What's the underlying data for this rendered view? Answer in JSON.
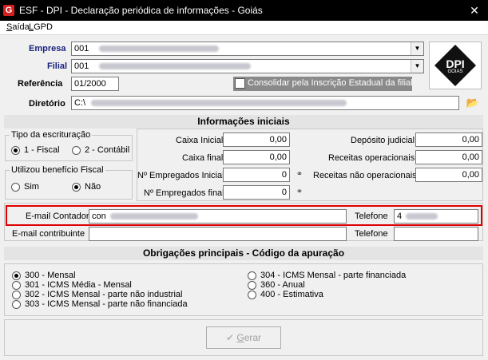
{
  "window": {
    "title": "ESF - DPI - Declaração periódica de informações - Goiás",
    "app_icon": "G",
    "close_icon": "✕"
  },
  "menu": {
    "items": [
      {
        "label_ul": "S",
        "label_rest": "aída"
      },
      {
        "label_ul": "L",
        "label_rest": "GPD"
      }
    ]
  },
  "header": {
    "empresa_label": "Empresa",
    "empresa_value": "001",
    "filial_label": "Filial",
    "filial_value": "001",
    "referencia_label": "Referência",
    "referencia_value": "01/2000",
    "consolidar_label": "Consolidar pela Inscrição Estadual da filial",
    "diretorio_label": "Diretório",
    "diretorio_value": "C:\\",
    "logo_text": "DPI",
    "logo_sub": "GOIAS"
  },
  "info_iniciais": {
    "title": "Informações iniciais",
    "escrituracao": {
      "title": "Tipo da escrituração",
      "opt1": "1 - Fiscal",
      "opt2": "2 - Contábil"
    },
    "beneficio": {
      "title": "Utilizou benefício Fiscal",
      "opt1": "Sim",
      "opt2": "Não"
    },
    "caixa_inicial_label": "Caixa Inicial",
    "caixa_inicial_value": "0,00",
    "caixa_final_label": "Caixa final",
    "caixa_final_value": "0,00",
    "empregados_inicial_label": "Nº Empregados Inicial",
    "empregados_inicial_value": "0",
    "empregados_final_label": "Nº Empregados final",
    "empregados_final_value": "0",
    "deposito_label": "Depósito judicial",
    "deposito_value": "0,00",
    "receitas_op_label": "Receitas operacionais",
    "receitas_op_value": "0,00",
    "receitas_nao_op_label": "Receitas não operacionais",
    "receitas_nao_op_value": "0,00"
  },
  "contatos": {
    "email_contador_label": "E-mail Contador",
    "email_contador_value": "con",
    "telefone_label": "Telefone",
    "telefone_value": "4",
    "email_contribuinte_label": "E-mail contribuinte",
    "email_contribuinte_value": "",
    "telefone2_label": "Telefone",
    "telefone2_value": ""
  },
  "obrigacoes": {
    "title": "Obrigações principais - Código da apuração",
    "col1": [
      "300 - Mensal",
      "301 - ICMS Média - Mensal",
      "302 - ICMS Mensal - parte não industrial",
      "303 - ICMS Mensal - parte não financiada"
    ],
    "col2": [
      "304 - ICMS Mensal - parte financiada",
      "360 - Anual",
      "400 - Estimativa"
    ],
    "selected": "300 - Mensal"
  },
  "footer": {
    "gerar_label": "Gerar",
    "gerar_ul": "G",
    "gerar_rest": "erar",
    "check_icon": "✔"
  },
  "colors": {
    "highlight": "#e00000",
    "label_blue": "#1a237e",
    "titlebar": "#000000"
  }
}
